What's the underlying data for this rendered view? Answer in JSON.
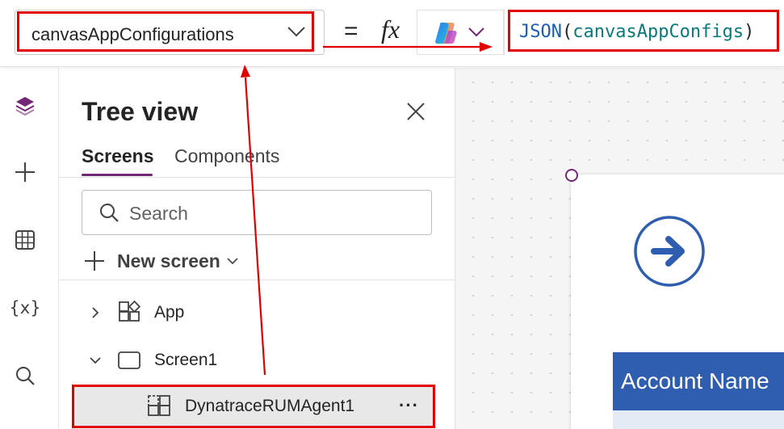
{
  "formula_bar": {
    "property_value": "canvasAppConfigurations",
    "equals": "=",
    "fx": "fx",
    "formula": {
      "function": "JSON",
      "open_paren": "(",
      "argument": "canvasAppConfigs",
      "close_paren": ")"
    }
  },
  "left_rail": {
    "items": [
      {
        "name": "tree-view",
        "icon": "layers-icon"
      },
      {
        "name": "insert",
        "icon": "plus-icon"
      },
      {
        "name": "data",
        "icon": "table-icon"
      },
      {
        "name": "variables",
        "icon": "variables-icon",
        "glyph": "{x}"
      },
      {
        "name": "search",
        "icon": "search-icon"
      }
    ]
  },
  "tree_view": {
    "title": "Tree view",
    "tabs": [
      {
        "label": "Screens",
        "active": true
      },
      {
        "label": "Components",
        "active": false
      }
    ],
    "search_placeholder": "Search",
    "new_screen_label": "New screen",
    "nodes": [
      {
        "label": "App",
        "expanded": false
      },
      {
        "label": "Screen1",
        "expanded": true
      },
      {
        "label": "DynatraceRUMAgent1",
        "selected": true,
        "more": "···"
      }
    ]
  },
  "canvas": {
    "header_label": "Account Name",
    "accent_color": "#2f5eb0"
  },
  "annotation_color": "#e00000"
}
